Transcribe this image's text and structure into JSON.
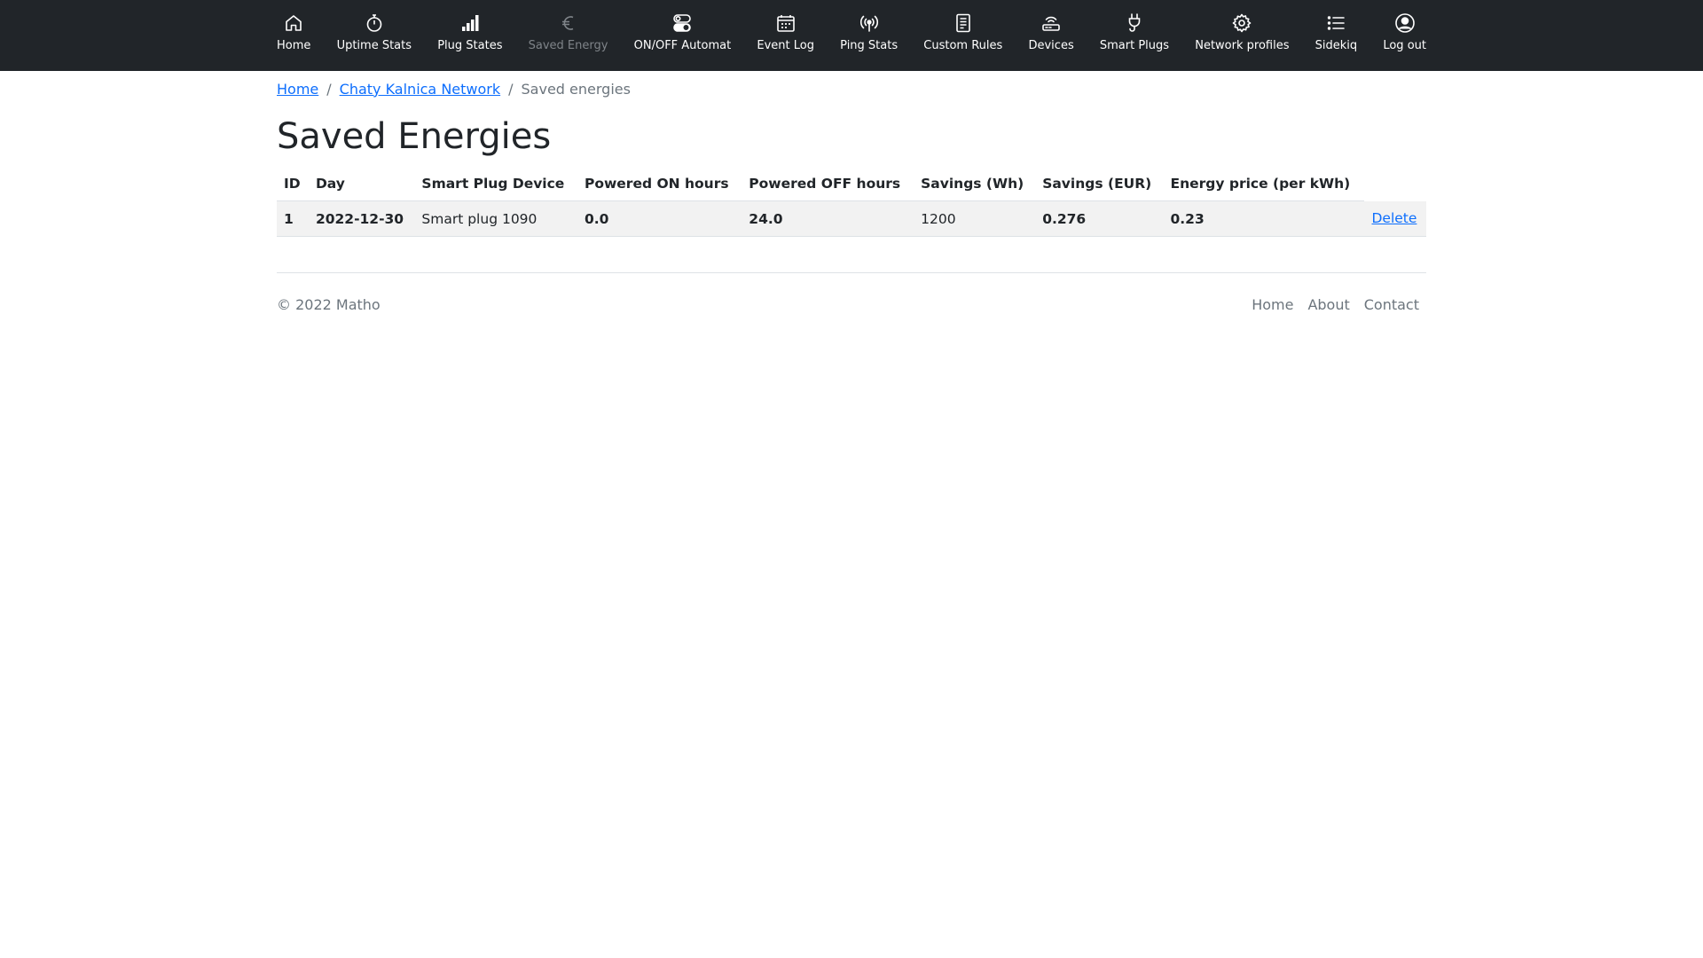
{
  "nav": {
    "items": [
      {
        "label": "Home",
        "icon": "home-icon"
      },
      {
        "label": "Uptime Stats",
        "icon": "stopwatch-icon"
      },
      {
        "label": "Plug States",
        "icon": "bar-chart-icon"
      },
      {
        "label": "Saved Energy",
        "icon": "euro-icon",
        "disabled": true
      },
      {
        "label": "ON/OFF Automat",
        "icon": "toggles-icon"
      },
      {
        "label": "Event Log",
        "icon": "calendar-icon"
      },
      {
        "label": "Ping Stats",
        "icon": "broadcast-icon"
      },
      {
        "label": "Custom Rules",
        "icon": "document-icon"
      },
      {
        "label": "Devices",
        "icon": "router-icon"
      },
      {
        "label": "Smart Plugs",
        "icon": "plug-icon"
      },
      {
        "label": "Network profiles",
        "icon": "gear-icon"
      },
      {
        "label": "Sidekiq",
        "icon": "list-icon"
      },
      {
        "label": "Log out",
        "icon": "person-circle-icon"
      }
    ]
  },
  "breadcrumb": {
    "home": "Home",
    "network": "Chaty Kalnica Network",
    "separator": "/",
    "current": "Saved energies"
  },
  "page": {
    "title": "Saved Energies"
  },
  "table": {
    "headers": [
      "ID",
      "Day",
      "Smart Plug Device",
      "Powered ON hours",
      "Powered OFF hours",
      "Savings (Wh)",
      "Savings (EUR)",
      "Energy price (per kWh)"
    ],
    "rows": [
      {
        "id": "1",
        "day": "2022-12-30",
        "device": "Smart plug 1090",
        "on_hours": "0.0",
        "off_hours": "24.0",
        "savings_wh": "1200",
        "savings_eur": "0.276",
        "price": "0.23",
        "action": "Delete"
      }
    ]
  },
  "footer": {
    "copyright": "© 2022 Matho",
    "links": [
      "Home",
      "About",
      "Contact"
    ]
  },
  "colors": {
    "navbar": "#212529",
    "link": "#0d6efd",
    "muted": "#6c757d",
    "row": "#f2f2f2"
  }
}
